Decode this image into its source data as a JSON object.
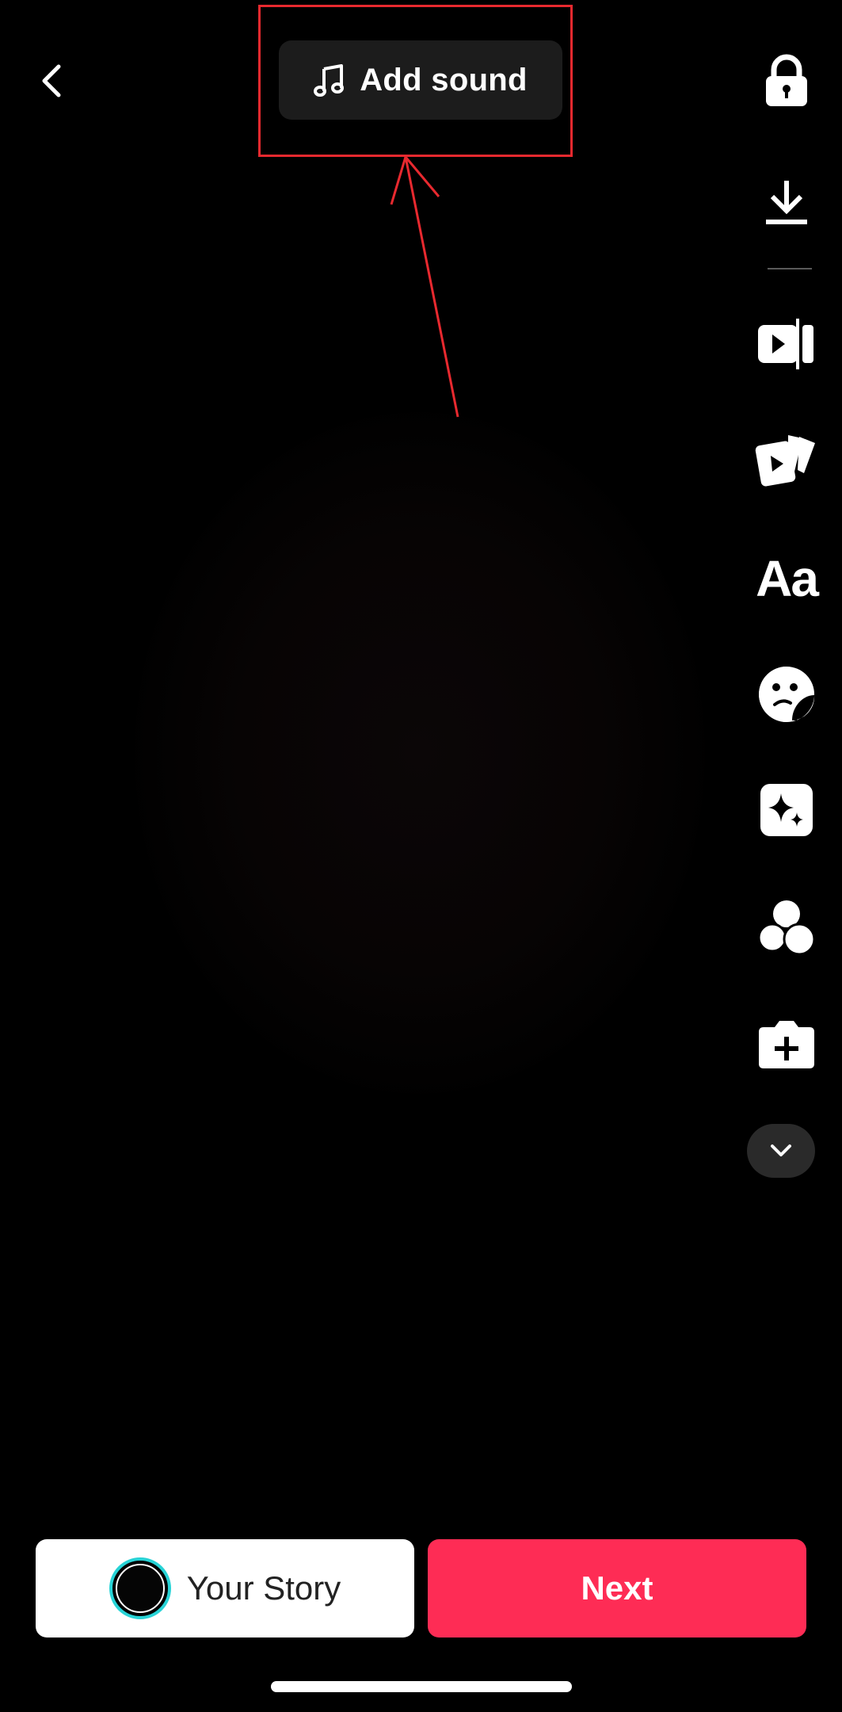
{
  "header": {
    "back_icon": "chevron-left-icon",
    "add_sound_label": "Add sound",
    "add_sound_icon": "music-note-icon"
  },
  "toolbar": {
    "items": [
      {
        "name": "lock",
        "icon": "lock-icon"
      },
      {
        "name": "download",
        "icon": "download-icon"
      },
      {
        "name": "edit",
        "icon": "edit-clip-icon"
      },
      {
        "name": "templates",
        "icon": "templates-icon"
      },
      {
        "name": "text",
        "icon": "text-icon",
        "label": "Aa"
      },
      {
        "name": "stickers",
        "icon": "sticker-icon"
      },
      {
        "name": "effects",
        "icon": "sparkle-effects-icon"
      },
      {
        "name": "filters",
        "icon": "filters-icon"
      },
      {
        "name": "add-clip",
        "icon": "camera-plus-icon"
      }
    ],
    "more_icon": "chevron-down-icon"
  },
  "footer": {
    "story_label": "Your Story",
    "next_label": "Next"
  },
  "colors": {
    "background": "#000000",
    "next_button": "#fe2c55",
    "avatar_ring": "#28d3d6",
    "annotation": "#e8292f"
  }
}
